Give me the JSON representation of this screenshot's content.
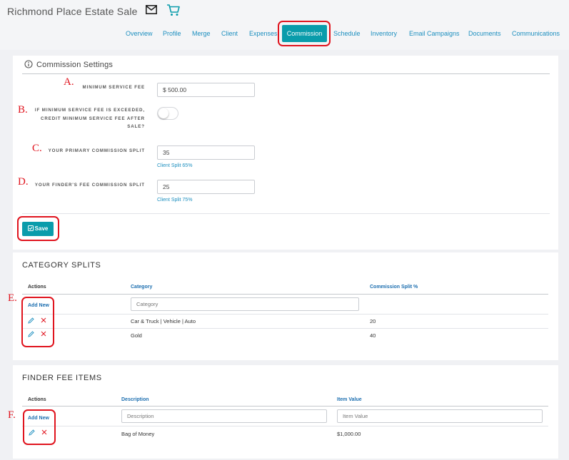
{
  "header": {
    "title": "Richmond Place Estate Sale",
    "icons": [
      "mail-icon",
      "cart-icon"
    ]
  },
  "nav": {
    "tabs": [
      {
        "label": "Overview"
      },
      {
        "label": "Profile"
      },
      {
        "label": "Merge"
      },
      {
        "label": "Client"
      },
      {
        "label": "Expenses"
      },
      {
        "label": "Commission",
        "active": true
      },
      {
        "label": "Schedule"
      },
      {
        "label": "Inventory"
      },
      {
        "label": "Email Campaigns"
      },
      {
        "label": "Documents"
      },
      {
        "label": "Communications"
      }
    ]
  },
  "annotations": {
    "markers": [
      "A.",
      "B.",
      "C.",
      "D.",
      "E.",
      "F."
    ],
    "color": "#e0141e"
  },
  "commission_settings": {
    "title": "Commission Settings",
    "minimum_service_fee": {
      "label": "MINIMUM SERVICE FEE",
      "value": "$ 500.00"
    },
    "credit_minimum_fee": {
      "label_lines": [
        "IF MINIMUM SERVICE FEE IS EXCEEDED,",
        "CREDIT MINIMUM SERVICE FEE AFTER",
        "SALE?"
      ],
      "enabled": false
    },
    "primary_split": {
      "label": "YOUR PRIMARY COMMISSION SPLIT",
      "value": "35",
      "hint": "Client Split 65%"
    },
    "finder_split": {
      "label": "YOUR FINDER'S FEE COMMISSION SPLIT",
      "value": "25",
      "hint": "Client Split 75%"
    },
    "save_label": "Save"
  },
  "category_splits": {
    "title": "CATEGORY SPLITS",
    "columns": [
      "Actions",
      "Category",
      "Commission Split %"
    ],
    "add_new_label": "Add New",
    "category_placeholder": "Category",
    "rows": [
      {
        "category": "Car & Truck | Vehicle | Auto",
        "split": "20"
      },
      {
        "category": "Gold",
        "split": "40"
      }
    ]
  },
  "finder_fee_items": {
    "title": "FINDER FEE ITEMS",
    "columns": [
      "Actions",
      "Description",
      "Item Value"
    ],
    "add_new_label": "Add New",
    "description_placeholder": "Description",
    "value_placeholder": "Item Value",
    "rows": [
      {
        "description": "Bag of Money",
        "value": "$1,000.00"
      }
    ]
  },
  "colors": {
    "accent": "#0a9cab",
    "link": "#1d8fbf",
    "header_link": "#1d6fb0",
    "delete": "#e0141e"
  }
}
